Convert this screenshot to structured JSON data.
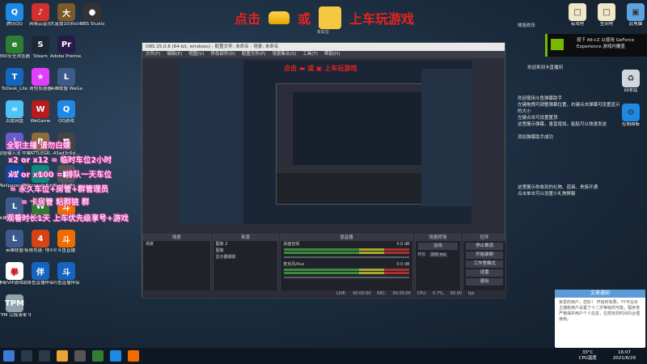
{
  "desktop": {
    "icons": [
      {
        "label": "腾讯QQ",
        "color": "#1e88e5",
        "glyph": "Q"
      },
      {
        "label": "网易云音乐",
        "color": "#d32f2f",
        "glyph": "♪"
      },
      {
        "label": "大富翁10(Richm...",
        "color": "#7b5a2a",
        "glyph": "大"
      },
      {
        "label": "OBS Studio",
        "color": "#333333",
        "glyph": "●"
      },
      {
        "label": "360安全浏览器",
        "color": "#2e7d32",
        "glyph": "e"
      },
      {
        "label": "Steam",
        "color": "#1b2838",
        "glyph": "S"
      },
      {
        "label": "Adobe Premie...",
        "color": "#2a1a4a",
        "glyph": "Pr"
      },
      {
        "label": "ToDesk_Lite",
        "color": "#1565c0",
        "glyph": "T"
      },
      {
        "label": "奇怪加速器",
        "color": "#e040fb",
        "glyph": "★"
      },
      {
        "label": "英雄联盟 WeGame版",
        "color": "#3c5b8a",
        "glyph": "L"
      },
      {
        "label": "百度网盘",
        "color": "#4fc3f7",
        "glyph": "∞"
      },
      {
        "label": "WeGame",
        "color": "#b71c1c",
        "glyph": "W"
      },
      {
        "label": "QQ游戏",
        "color": "#1e88e5",
        "glyph": "Q"
      },
      {
        "label": "动感输入法 中文版",
        "color": "#6a5acd",
        "glyph": "i"
      },
      {
        "label": "BATTLEGR...",
        "color": "#8d6e3b",
        "glyph": "B"
      },
      {
        "label": "43ad3c6d...",
        "color": "#444444",
        "glyph": "■"
      },
      {
        "label": "Wallpaper Engine:...",
        "color": "#0d47a1",
        "glyph": "W"
      },
      {
        "label": "Microsoft Edge",
        "color": "#0b8b7b",
        "glyph": "e"
      },
      {
        "label": "7ba53d8b...",
        "color": "#555555",
        "glyph": "■"
      },
      {
        "label": "英雄联盟 WeGame版",
        "color": "#3c5b8a",
        "glyph": "L"
      },
      {
        "label": "微信",
        "color": "#2e7d32",
        "glyph": "W"
      },
      {
        "label": "斗鱼直播",
        "color": "#ef6c00",
        "glyph": "斗"
      },
      {
        "label": "英雄联盟",
        "color": "#3c5b8a",
        "glyph": "L"
      },
      {
        "label": "极限竞速: 地平线 4",
        "color": "#d84315",
        "glyph": "4"
      },
      {
        "label": "斗鱼直播",
        "color": "#ef6c00",
        "glyph": "斗"
      },
      {
        "label": "拳新VIP游戏助手",
        "color": "#ffffff",
        "glyph": "拳"
      },
      {
        "label": "斗鱼直播伴侣",
        "color": "#1565c0",
        "glyph": "伴"
      },
      {
        "label": "斗鱼直播伴侣",
        "color": "#1565c0",
        "glyph": "斗"
      },
      {
        "label": "TPM 完成清单 中文版",
        "color": "#90a4ae",
        "glyph": "TPM"
      }
    ],
    "right_icons": [
      {
        "label": "有戏吧",
        "color": "#f0e6c8",
        "glyph": "□"
      },
      {
        "label": "签到吧",
        "color": "#f0e6c8",
        "glyph": "□"
      },
      {
        "label": "此电脑",
        "color": "#5da3e0",
        "glyph": "▣"
      },
      {
        "label": "回收站",
        "color": "#cfd8dc",
        "glyph": "♻"
      },
      {
        "label": "控制面板",
        "color": "#1e88e5",
        "glyph": "⚙"
      }
    ]
  },
  "banner": {
    "click": "点击",
    "or": "或",
    "action": "上车玩游戏",
    "box_caption": "有车位"
  },
  "obs": {
    "title": "OBS 25.0.8 (64-bit, windows) - 配置文件: 未命名 - 场景: 未命名",
    "menu": [
      "文件(F)",
      "编辑(E)",
      "视图(V)",
      "停靠部件(D)",
      "配置文件(P)",
      "场景集合(S)",
      "工具(T)",
      "帮助(H)"
    ],
    "docks": {
      "scenes_title": "场景",
      "scene_item": "场景",
      "sources_title": "来源",
      "sources": [
        "图像 2",
        "图像",
        "显示器捕获"
      ],
      "mixer_title": "混音器",
      "mixer": [
        {
          "name": "桌面音频",
          "level": "0.0 dB"
        },
        {
          "name": "麦克风/Aux",
          "level": "0.0 dB"
        }
      ],
      "transition_title": "场景转场",
      "transition_type": "淡出",
      "duration_label": "时长",
      "duration_value": "300 ms",
      "controls_title": "控件",
      "controls": [
        "停止推流",
        "开始录制",
        "工作室模式",
        "设置",
        "退出"
      ]
    },
    "status": "LIVE: 00:00:00   REC: 00:00:00   CPU: 0.7%, 60.00 fps"
  },
  "overlay_lines": [
    "全职主播 请勿白嫖",
    "x2 or x12 = 临时车位2小时",
    "x1 or x100 = 排队一天车位",
    "= 永久车位+房管+群管理员",
    "= 卡房管 粘群链 群",
    "观看时长1天 上车优先级享号+游戏"
  ],
  "right_panel": {
    "top_label": "体验欢乐",
    "count": "928",
    "nvidia_text": "按下 Alt+Z 以使用 GeForce Experience 游戏内覆盖",
    "lines": [
      "欢迎来到卡直播间",
      "欢迎使用斗鱼弹幕助手",
      "左键拖拽可调整弹幕位置，右键点击弹幕可设置显示的大小",
      "左键点击可设置置顶",
      "这里展示弹幕，垂直增加，粘贴可以快速发送",
      "添加弹幕助手成功",
      "这里展示你收到的礼物、道具、贵族开通",
      "点击单击可以设置小礼物屏蔽"
    ]
  },
  "notification": {
    "title": "文章通知",
    "body": "亲爱的用户，您好！ 开始时有限，YY平台对主播和用户设置了十二岁等级的可能，程序将严格保护用户个人信息，在规定的时间内合理使用。"
  },
  "taskbar": {
    "temp": "33°C",
    "cpu": "CPU温度",
    "time": "16:07",
    "date": "2021/6/29"
  }
}
